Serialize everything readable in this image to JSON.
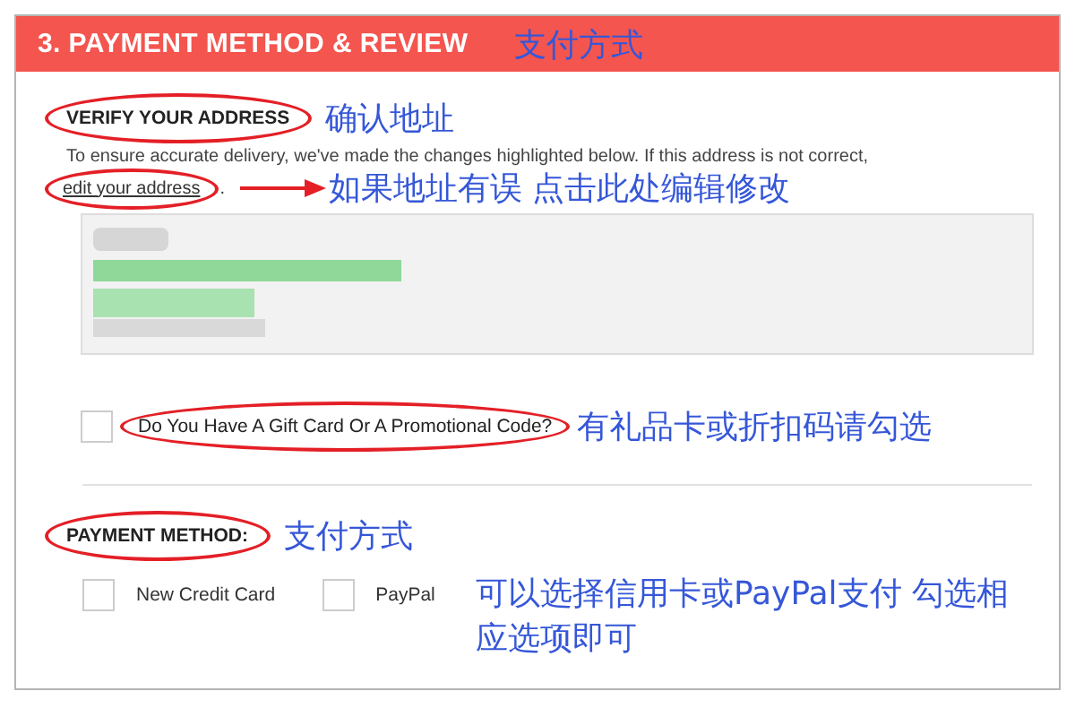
{
  "header": {
    "title": "3. PAYMENT METHOD & REVIEW",
    "note": "支付方式"
  },
  "verify": {
    "heading": "VERIFY YOUR ADDRESS",
    "circled": true,
    "note": "确认地址",
    "description": "To ensure accurate delivery, we've made the changes highlighted below. If this address is not correct,",
    "link": "edit your address",
    "link_suffix": ".",
    "link_circled": true,
    "link_note": "如果地址有误 点击此处编辑修改"
  },
  "gift": {
    "label": "Do You Have A Gift Card Or A Promotional Code?",
    "checked": false,
    "circled": true,
    "note": "有礼品卡或折扣码请勾选"
  },
  "payment": {
    "heading": "PAYMENT METHOD:",
    "circled": true,
    "note": "支付方式",
    "options": [
      {
        "label": "New Credit Card",
        "checked": false
      },
      {
        "label": "PayPal",
        "checked": false
      }
    ],
    "options_note": "可以选择信用卡或PayPal支付 勾选相应选项即可"
  }
}
